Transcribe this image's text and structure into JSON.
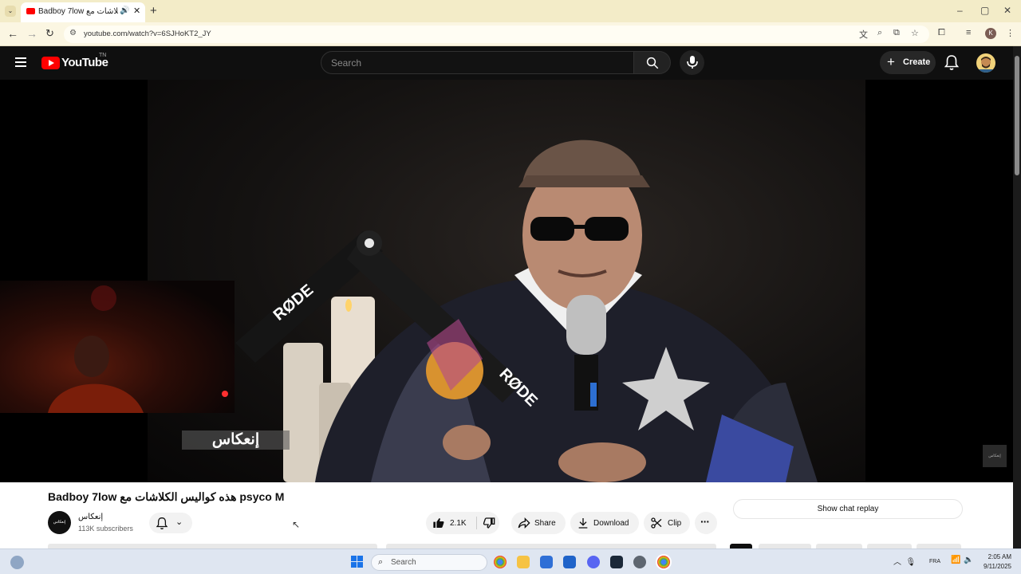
{
  "browser": {
    "tab_title": "Badboy 7low هذه كواليس الكلاشات مع",
    "tab_close": "✕",
    "new_tab": "+",
    "url": "youtube.com/watch?v=6SJHoKT2_JY",
    "profile_initial": "K",
    "window_controls": {
      "minimize": "–",
      "maximize": "▢",
      "close": "✕"
    }
  },
  "masthead": {
    "logo_text": "YouTube",
    "logo_region": "TN",
    "search_placeholder": "Search",
    "create_label": "Create"
  },
  "video": {
    "overlay_text": "إنعكاس",
    "watermark_label": "إنعكاس"
  },
  "below": {
    "title": "Badboy 7low هذه كواليس الكلاشات مع psyco M",
    "channel_name": "إنعكاس",
    "channel_avatar_text": "إنعكاس",
    "subscribers": "113K subscribers",
    "like_count": "2.1K",
    "share_label": "Share",
    "download_label": "Download",
    "clip_label": "Clip",
    "chat_replay_label": "Show chat replay"
  },
  "taskbar": {
    "search_placeholder": "Search",
    "language": "FRA",
    "time": "2:05 AM",
    "date": "9/11/2025"
  },
  "colors": {
    "youtube_red": "#ff0000",
    "page_bg": "#0f0f0f",
    "chrome_tab_strip": "#f3ecc8"
  }
}
